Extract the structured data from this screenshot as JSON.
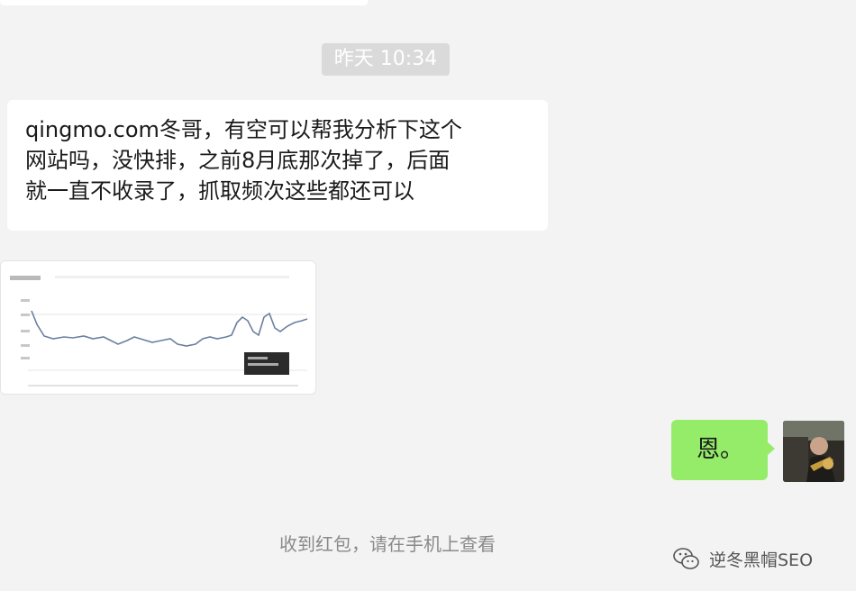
{
  "chat": {
    "timestamp": "昨天 10:34",
    "incoming_message_lines": [
      "qingmo.com冬哥，有空可以帮我分析下这个",
      "网站吗，没快排，之前8月底那次掉了，后面",
      "就一直不收录了，抓取频次这些都还可以"
    ],
    "outgoing_message": "恩。",
    "system_notice": "收到红包，请在手机上查看"
  },
  "watermark": {
    "text": "逆冬黑帽SEO",
    "icon": "wechat-official-account-icon"
  },
  "colors": {
    "background": "#f3f3f3",
    "incoming_bubble": "#ffffff",
    "outgoing_bubble": "#95ec69",
    "timestamp_bg": "#dadada"
  }
}
